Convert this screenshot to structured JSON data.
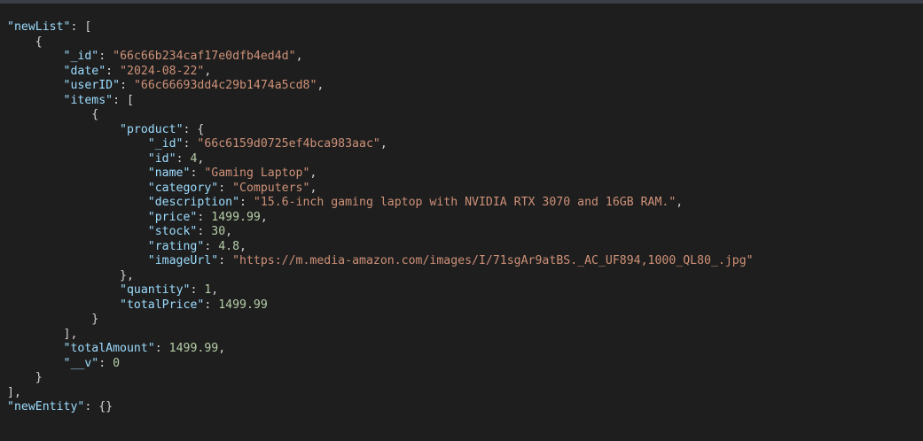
{
  "theme": {
    "background": "#1e1e1e",
    "key_color": "#9cdcfe",
    "string_color": "#ce9178",
    "number_color": "#b5cea8",
    "punctuation_color": "#d4d4d4"
  },
  "json_viewer": {
    "lines": [
      {
        "indent": "",
        "tokens": [
          [
            "k",
            "\"newList\""
          ],
          [
            "p",
            ": ["
          ]
        ]
      },
      {
        "indent": "    ",
        "tokens": [
          [
            "p",
            "{"
          ]
        ]
      },
      {
        "indent": "        ",
        "tokens": [
          [
            "k",
            "\"_id\""
          ],
          [
            "p",
            ": "
          ],
          [
            "s",
            "\"66c66b234caf17e0dfb4ed4d\""
          ],
          [
            "p",
            ","
          ]
        ]
      },
      {
        "indent": "        ",
        "tokens": [
          [
            "k",
            "\"date\""
          ],
          [
            "p",
            ": "
          ],
          [
            "s",
            "\"2024-08-22\""
          ],
          [
            "p",
            ","
          ]
        ]
      },
      {
        "indent": "        ",
        "tokens": [
          [
            "k",
            "\"userID\""
          ],
          [
            "p",
            ": "
          ],
          [
            "s",
            "\"66c66693dd4c29b1474a5cd8\""
          ],
          [
            "p",
            ","
          ]
        ]
      },
      {
        "indent": "        ",
        "tokens": [
          [
            "k",
            "\"items\""
          ],
          [
            "p",
            ": ["
          ]
        ]
      },
      {
        "indent": "            ",
        "tokens": [
          [
            "p",
            "{"
          ]
        ]
      },
      {
        "indent": "                ",
        "tokens": [
          [
            "k",
            "\"product\""
          ],
          [
            "p",
            ": {"
          ]
        ]
      },
      {
        "indent": "                    ",
        "tokens": [
          [
            "k",
            "\"_id\""
          ],
          [
            "p",
            ": "
          ],
          [
            "s",
            "\"66c6159d0725ef4bca983aac\""
          ],
          [
            "p",
            ","
          ]
        ]
      },
      {
        "indent": "                    ",
        "tokens": [
          [
            "k",
            "\"id\""
          ],
          [
            "p",
            ": "
          ],
          [
            "n",
            "4"
          ],
          [
            "p",
            ","
          ]
        ]
      },
      {
        "indent": "                    ",
        "tokens": [
          [
            "k",
            "\"name\""
          ],
          [
            "p",
            ": "
          ],
          [
            "s",
            "\"Gaming Laptop\""
          ],
          [
            "p",
            ","
          ]
        ]
      },
      {
        "indent": "                    ",
        "tokens": [
          [
            "k",
            "\"category\""
          ],
          [
            "p",
            ": "
          ],
          [
            "s",
            "\"Computers\""
          ],
          [
            "p",
            ","
          ]
        ]
      },
      {
        "indent": "                    ",
        "tokens": [
          [
            "k",
            "\"description\""
          ],
          [
            "p",
            ": "
          ],
          [
            "s",
            "\"15.6-inch gaming laptop with NVIDIA RTX 3070 and 16GB RAM.\""
          ],
          [
            "p",
            ","
          ]
        ]
      },
      {
        "indent": "                    ",
        "tokens": [
          [
            "k",
            "\"price\""
          ],
          [
            "p",
            ": "
          ],
          [
            "n",
            "1499.99"
          ],
          [
            "p",
            ","
          ]
        ]
      },
      {
        "indent": "                    ",
        "tokens": [
          [
            "k",
            "\"stock\""
          ],
          [
            "p",
            ": "
          ],
          [
            "n",
            "30"
          ],
          [
            "p",
            ","
          ]
        ]
      },
      {
        "indent": "                    ",
        "tokens": [
          [
            "k",
            "\"rating\""
          ],
          [
            "p",
            ": "
          ],
          [
            "n",
            "4.8"
          ],
          [
            "p",
            ","
          ]
        ]
      },
      {
        "indent": "                    ",
        "tokens": [
          [
            "k",
            "\"imageUrl\""
          ],
          [
            "p",
            ": "
          ],
          [
            "s",
            "\"https://m.media-amazon.com/images/I/71sgAr9atBS._AC_UF894,1000_QL80_.jpg\""
          ]
        ]
      },
      {
        "indent": "                ",
        "tokens": [
          [
            "p",
            "},"
          ]
        ]
      },
      {
        "indent": "                ",
        "tokens": [
          [
            "k",
            "\"quantity\""
          ],
          [
            "p",
            ": "
          ],
          [
            "n",
            "1"
          ],
          [
            "p",
            ","
          ]
        ]
      },
      {
        "indent": "                ",
        "tokens": [
          [
            "k",
            "\"totalPrice\""
          ],
          [
            "p",
            ": "
          ],
          [
            "n",
            "1499.99"
          ]
        ]
      },
      {
        "indent": "            ",
        "tokens": [
          [
            "p",
            "}"
          ]
        ]
      },
      {
        "indent": "        ",
        "tokens": [
          [
            "p",
            "],"
          ]
        ]
      },
      {
        "indent": "        ",
        "tokens": [
          [
            "k",
            "\"totalAmount\""
          ],
          [
            "p",
            ": "
          ],
          [
            "n",
            "1499.99"
          ],
          [
            "p",
            ","
          ]
        ]
      },
      {
        "indent": "        ",
        "tokens": [
          [
            "k",
            "\"__v\""
          ],
          [
            "p",
            ": "
          ],
          [
            "n",
            "0"
          ]
        ]
      },
      {
        "indent": "    ",
        "tokens": [
          [
            "p",
            "}"
          ]
        ]
      },
      {
        "indent": "",
        "tokens": [
          [
            "p",
            "],"
          ]
        ]
      },
      {
        "indent": "",
        "tokens": [
          [
            "k",
            "\"newEntity\""
          ],
          [
            "p",
            ": {}"
          ]
        ]
      }
    ]
  }
}
